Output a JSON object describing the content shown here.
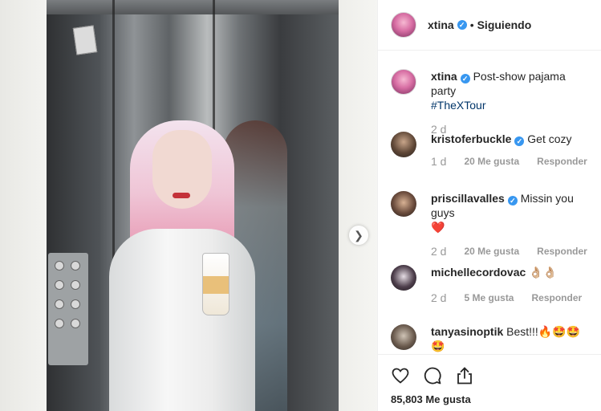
{
  "post": {
    "author": "xtina",
    "follow_state": "Siguiendo",
    "separator": "•",
    "likes_total": "85,803 Me gusta"
  },
  "caption": {
    "username": "xtina",
    "text": "Post-show pajama party",
    "hashtag": "#TheXTour",
    "age": "2 d"
  },
  "comments": [
    {
      "username": "kristoferbuckle",
      "text": "Get cozy",
      "age": "1 d",
      "likes": "20 Me gusta",
      "reply": "Responder"
    },
    {
      "username": "priscillavalles",
      "text": "Missin you guys",
      "emoji": "❤️",
      "age": "2 d",
      "likes": "20 Me gusta",
      "reply": "Responder"
    },
    {
      "username": "michellecordovac",
      "text": "👌🏼👌🏼",
      "age": "2 d",
      "likes": "5 Me gusta",
      "reply": "Responder"
    },
    {
      "username": "tanyasinoptik",
      "text": "Best!!!🔥🤩🤩🤩",
      "age": "",
      "likes": "",
      "reply": ""
    }
  ],
  "icons": {
    "like": "heart-icon",
    "comment": "speech-bubble-icon",
    "share": "share-icon",
    "verified": "verified-badge-icon",
    "next": "chevron-right-icon"
  },
  "colors": {
    "verified": "#3897f0",
    "hashtag": "#003569",
    "muted": "#999999",
    "text": "#262626"
  }
}
